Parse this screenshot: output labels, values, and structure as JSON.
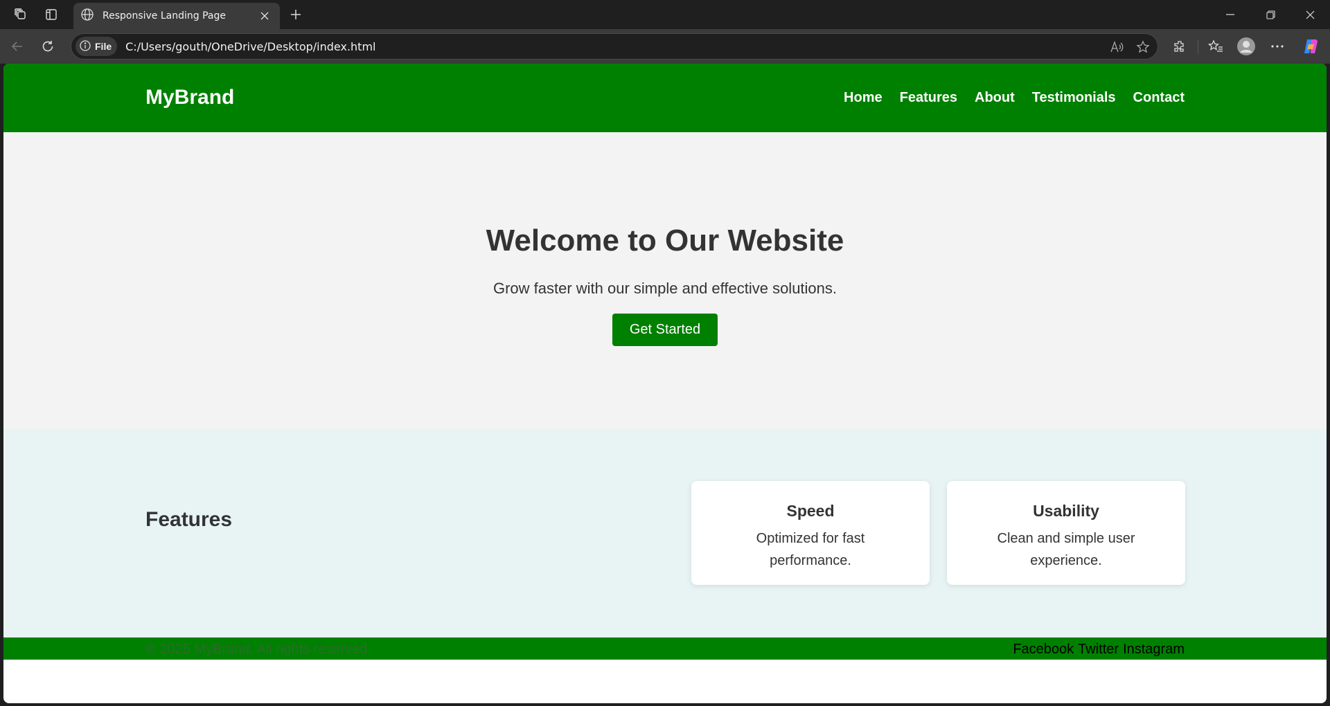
{
  "browser": {
    "tab_title": "Responsive Landing Page",
    "site_chip": "File",
    "url": "C:/Users/gouth/OneDrive/Desktop/index.html"
  },
  "site": {
    "brand": "MyBrand",
    "nav": [
      "Home",
      "Features",
      "About",
      "Testimonials",
      "Contact"
    ],
    "hero": {
      "title": "Welcome to Our Website",
      "subtitle": "Grow faster with our simple and effective solutions.",
      "cta_label": "Get Started"
    },
    "features": {
      "title": "Features",
      "cards": [
        {
          "title": "Speed",
          "text": "Optimized for fast performance."
        },
        {
          "title": "Usability",
          "text": "Clean and simple user experience."
        }
      ]
    },
    "footer": {
      "copyright": "© 2025 MyBrand. All rights reserved.",
      "social": [
        "Facebook",
        "Twitter",
        "Instagram"
      ]
    }
  },
  "colors": {
    "brand_green": "#008000",
    "hero_bg": "#f3f3f3",
    "features_bg": "#e8f4f4",
    "chrome_dark": "#1f1f1f"
  }
}
